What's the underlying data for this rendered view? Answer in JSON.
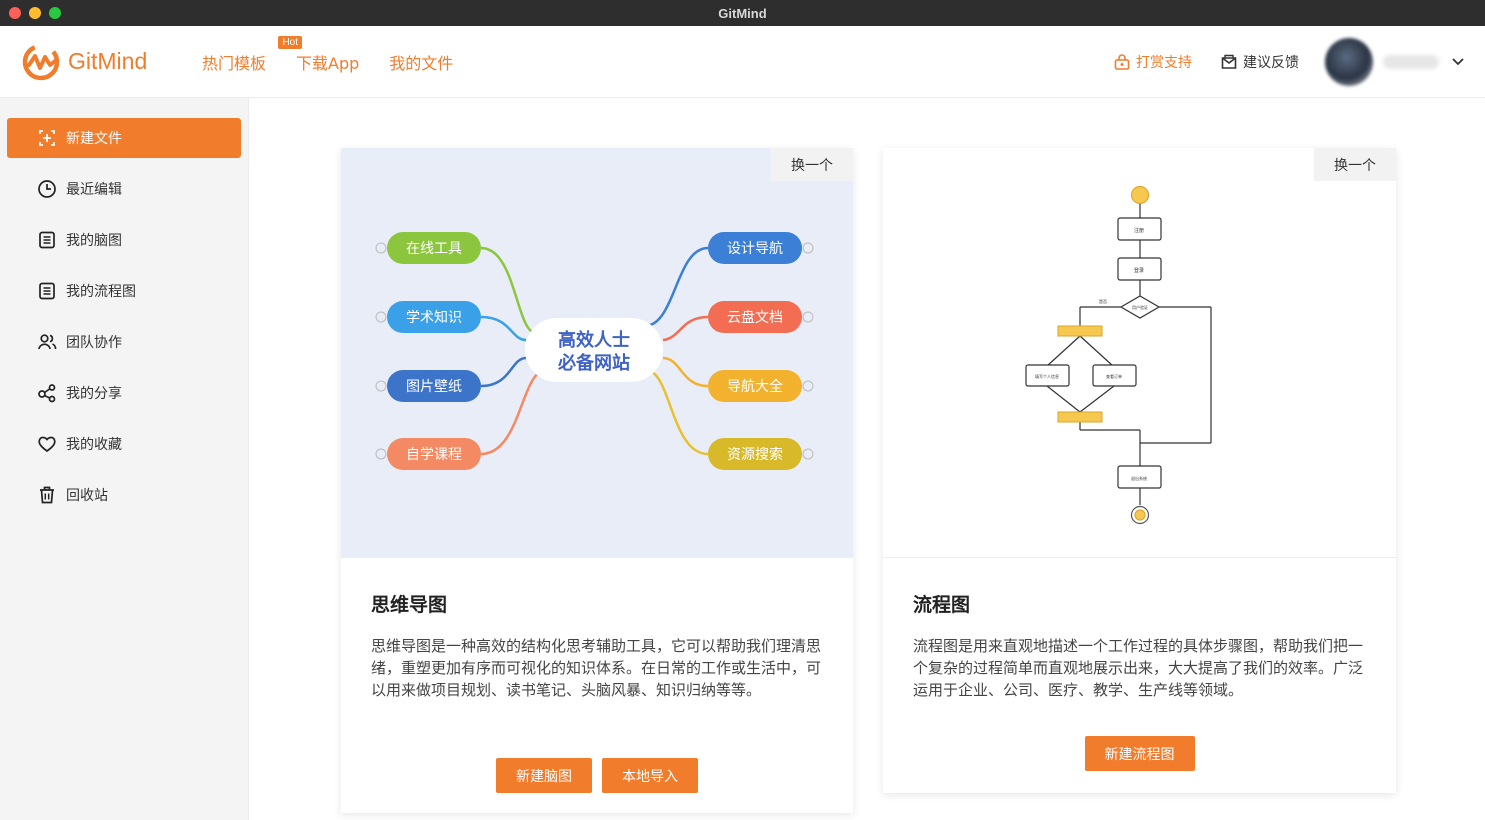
{
  "window": {
    "title": "GitMind"
  },
  "brand": {
    "name": "GitMind",
    "accent": "#f07c2c"
  },
  "nav": {
    "links": [
      {
        "label": "热门模板",
        "badge": "Hot"
      },
      {
        "label": "下载App"
      },
      {
        "label": "我的文件"
      }
    ],
    "tip_label": "打赏支持",
    "feedback_label": "建议反馈"
  },
  "sidebar": {
    "items": [
      {
        "label": "新建文件",
        "icon": "plus-square-icon",
        "active": true
      },
      {
        "label": "最近编辑",
        "icon": "clock-icon"
      },
      {
        "label": "我的脑图",
        "icon": "document-icon"
      },
      {
        "label": "我的流程图",
        "icon": "document-icon"
      },
      {
        "label": "团队协作",
        "icon": "people-icon"
      },
      {
        "label": "我的分享",
        "icon": "share-icon"
      },
      {
        "label": "我的收藏",
        "icon": "heart-icon"
      },
      {
        "label": "回收站",
        "icon": "trash-icon"
      }
    ]
  },
  "cards": {
    "mind": {
      "swap_label": "换一个",
      "title": "思维导图",
      "desc": "思维导图是一种高效的结构化思考辅助工具，它可以帮助我们理清思绪，重塑更加有序而可视化的知识体系。在日常的工作或生活中，可以用来做项目规划、读书笔记、头脑风暴、知识归纳等等。",
      "buttons": [
        "新建脑图",
        "本地导入"
      ],
      "preview": {
        "center_line1": "高效人士",
        "center_line2": "必备网站",
        "left_nodes": [
          "在线工具",
          "学术知识",
          "图片壁纸",
          "自学课程"
        ],
        "right_nodes": [
          "设计导航",
          "云盘文档",
          "导航大全",
          "资源搜索"
        ]
      }
    },
    "flow": {
      "swap_label": "换一个",
      "title": "流程图",
      "desc": "流程图是用来直观地描述一个工作过程的具体步骤图，帮助我们把一个复杂的过程简单而直观地展示出来，大大提高了我们的效率。广泛运用于企业、公司、医疗、教学、生产线等领域。",
      "buttons": [
        "新建流程图"
      ],
      "preview": {
        "step1": "注册",
        "step2": "登录",
        "decision": "用户验证",
        "branch_label": "是否",
        "left_step": "填写个人信息",
        "right_step": "查看订单",
        "end_step": "退出系统"
      }
    }
  }
}
